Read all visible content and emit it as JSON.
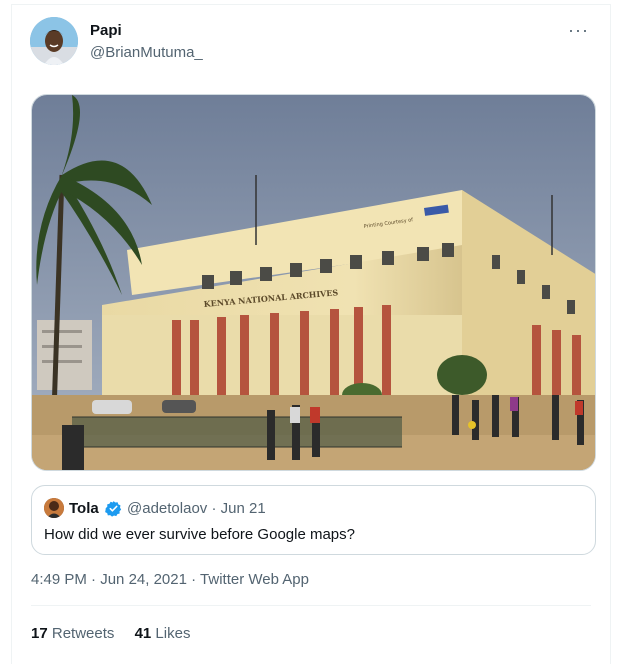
{
  "tweet": {
    "author": {
      "display_name": "Papi",
      "handle": "@BrianMutuma_"
    },
    "more_icon": "more-horizontal-icon",
    "media": {
      "building_sign": "KENYA NATIONAL ARCHIVES",
      "top_sign": "Printing Courtesy of"
    },
    "quote": {
      "display_name": "Tola",
      "verified": true,
      "handle": "@adetolaov",
      "separator": "·",
      "date": "Jun 21",
      "text": "How did we ever survive before Google maps?"
    },
    "meta": {
      "time": "4:49 PM",
      "separator1": "·",
      "date": "Jun 24, 2021",
      "separator2": "·",
      "source": "Twitter Web App"
    },
    "stats": {
      "retweets_count": "17",
      "retweets_label": "Retweets",
      "likes_count": "41",
      "likes_label": "Likes"
    }
  },
  "colors": {
    "text_primary": "#0f1419",
    "text_secondary": "#536471",
    "border": "#cfd9de",
    "verified_blue": "#1d9bf0"
  }
}
